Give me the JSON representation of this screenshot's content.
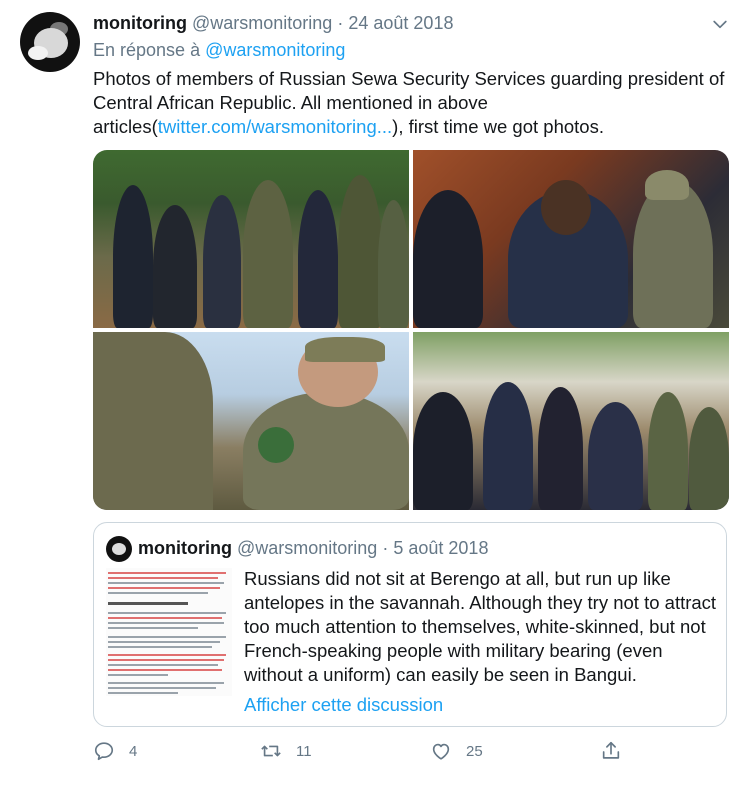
{
  "tweet": {
    "author_name": "monitoring",
    "author_handle": "@warsmonitoring",
    "separator": "·",
    "date": "24 août 2018",
    "reply_prefix": "En réponse à",
    "reply_mention": "@warsmonitoring",
    "text_before_link": "Photos of members of  Russian Sewa Security Services guarding president of Central African Republic. All mentioned in above articles(",
    "text_link": "twitter.com/warsmonitoring...",
    "text_after_link": "), first time we got photos."
  },
  "quoted_tweet": {
    "author_name": "monitoring",
    "author_handle": "@warsmonitoring",
    "separator": "·",
    "date": "5 août 2018",
    "text": "Russians did not sit at Berengo at all, but run up like antelopes in the savannah. Although they try not to attract too much attention to themselves, white-skinned, but not French-speaking people with military bearing (even without a uniform) can easily be seen in Bangui.",
    "show_thread_label": "Afficher cette discussion"
  },
  "actions": {
    "reply_count": "4",
    "retweet_count": "11",
    "like_count": "25"
  },
  "icons": {
    "menu": "chevron-down-icon",
    "reply": "reply-icon",
    "retweet": "retweet-icon",
    "like": "like-icon",
    "share": "share-icon"
  },
  "colors": {
    "link": "#1da1f2",
    "secondary_text": "#657786",
    "primary_text": "#14171a",
    "border": "#ccd6dd"
  }
}
